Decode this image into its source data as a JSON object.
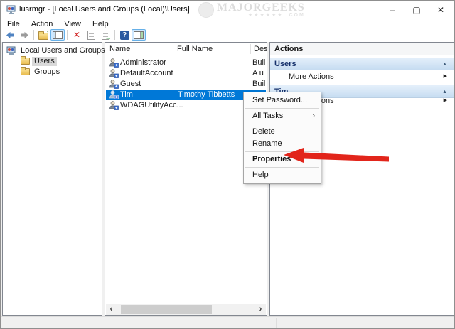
{
  "window": {
    "title": "lusrmgr - [Local Users and Groups (Local)\\Users]",
    "controls": {
      "minimize": "–",
      "maximize": "▢",
      "close": "✕"
    }
  },
  "watermark": {
    "line1": "MAJORGEEKS",
    "line2": "★★★★★★ .COM"
  },
  "menu_bar": {
    "items": [
      "File",
      "Action",
      "View",
      "Help"
    ]
  },
  "toolbar": {
    "icons": [
      "back",
      "forward",
      "up-folder",
      "show-hide-console-tree",
      "delete",
      "properties",
      "export-list",
      "help",
      "show-hide-action-pane"
    ],
    "help_glyph": "?",
    "delete_glyph": "✕"
  },
  "tree": {
    "root": "Local Users and Groups (Local)",
    "items": [
      {
        "label": "Users",
        "selected": true
      },
      {
        "label": "Groups",
        "selected": false
      }
    ]
  },
  "list": {
    "columns": [
      "Name",
      "Full Name",
      "Des"
    ],
    "rows": [
      {
        "name": "Administrator",
        "full_name": "",
        "description": "Buil",
        "selected": false
      },
      {
        "name": "DefaultAccount",
        "full_name": "",
        "description": "A u",
        "selected": false
      },
      {
        "name": "Guest",
        "full_name": "",
        "description": "Buil",
        "selected": false
      },
      {
        "name": "Tim",
        "full_name": "Timothy Tibbetts",
        "description": "",
        "selected": true
      },
      {
        "name": "WDAGUtilityAcc...",
        "full_name": "",
        "description": "",
        "selected": false
      }
    ]
  },
  "actions_pane": {
    "title": "Actions",
    "sections": [
      {
        "title": "Users",
        "action": "More Actions"
      },
      {
        "title": "Tim",
        "action": "More Actions"
      }
    ]
  },
  "context_menu": {
    "items": [
      {
        "label": "Set Password...",
        "has_submenu": false,
        "bold": false
      },
      {
        "label": "All Tasks",
        "has_submenu": true,
        "bold": false
      },
      {
        "label": "Delete",
        "has_submenu": false,
        "bold": false
      },
      {
        "label": "Rename",
        "has_submenu": false,
        "bold": false
      },
      {
        "label": "Properties",
        "has_submenu": false,
        "bold": true
      },
      {
        "label": "Help",
        "has_submenu": false,
        "bold": false
      }
    ]
  },
  "icons": {
    "section_collapse": "▲",
    "more_expand": "▶",
    "submenu_arrow": "›",
    "scroll_left": "‹",
    "scroll_right": "›",
    "folder_up_arrow": "↑",
    "export_arrow": "→"
  },
  "colors": {
    "selection": "#0078d7",
    "selection_inactive": "#d9d9d9",
    "arrow_red": "#e2251b",
    "section_header_top": "#e5f0fb",
    "section_header_bottom": "#c6dcf1"
  }
}
